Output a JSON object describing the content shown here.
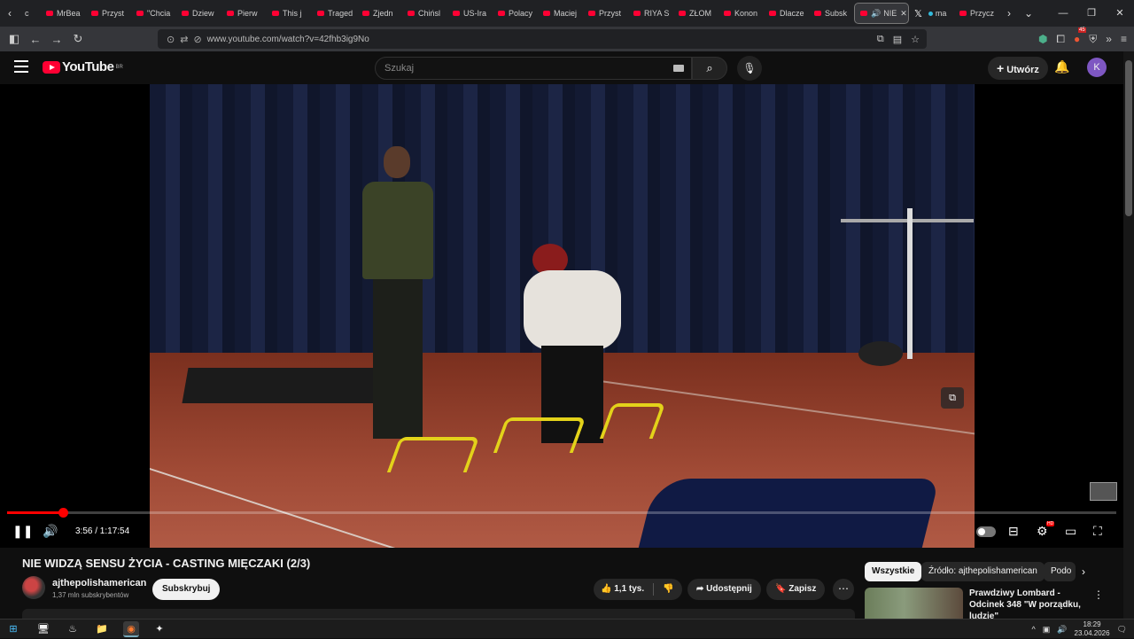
{
  "browser": {
    "tabs": [
      {
        "label": "MrBea"
      },
      {
        "label": "Przyst"
      },
      {
        "label": "\"Chcia"
      },
      {
        "label": "Dziew"
      },
      {
        "label": "Pierw"
      },
      {
        "label": "This j"
      },
      {
        "label": "Traged"
      },
      {
        "label": "Zjedn"
      },
      {
        "label": "Chińsl"
      },
      {
        "label": "US-Ira"
      },
      {
        "label": "Polacy"
      },
      {
        "label": "Maciej"
      },
      {
        "label": "Przyst"
      },
      {
        "label": "RIYA S"
      },
      {
        "label": "ZŁOM"
      },
      {
        "label": "Konon"
      },
      {
        "label": "Dlacze"
      },
      {
        "label": "Subsk"
      }
    ],
    "active_tab": "NIE",
    "x_tab": "ma",
    "after_tab": "Przycz",
    "first_tab_partial": "c",
    "url": "www.youtube.com/watch?v=42fhb3ig9No",
    "extension_badge": "45"
  },
  "youtube": {
    "logo_text": "YouTube",
    "region": "BR",
    "search_placeholder": "Szukaj",
    "create_label": "Utwórz",
    "avatar_letter": "K"
  },
  "player": {
    "current_time": "3:56",
    "duration": "1:17:54",
    "time_display": "3:56 / 1:17:54",
    "progress": 0.0505,
    "quality_badge": "HD"
  },
  "video": {
    "title": "NIE WIDZĄ SENSU ŻYCIA - CASTING MIĘCZAKI (2/3)",
    "channel_name": "ajthepolishamerican",
    "subscribers": "1,37 mln subskrybentów",
    "subscribe_label": "Subskrybuj",
    "likes": "1,1 tys.",
    "share_label": "Udostępnij",
    "save_label": "Zapisz"
  },
  "sidebar": {
    "chips": [
      {
        "label": "Wszystkie",
        "selected": true
      },
      {
        "label": "Źródło: ajthepolishamerican",
        "selected": false
      },
      {
        "label": "Podo",
        "selected": false
      }
    ],
    "recommendation": {
      "title": "Prawdziwy Lombard - Odcinek 348 \"W porządku, ludzie\""
    }
  },
  "taskbar": {
    "time": "18:29",
    "date": "23.04.2026"
  }
}
